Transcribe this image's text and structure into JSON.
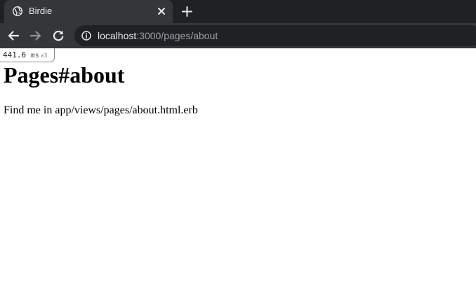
{
  "browser": {
    "tab": {
      "title": "Birdie",
      "favicon": "globe-icon",
      "close": "close-icon"
    },
    "new_tab": "plus-icon",
    "nav": {
      "back": "back-arrow-icon",
      "forward": "forward-arrow-icon",
      "reload": "reload-icon"
    },
    "address": {
      "security": "info-icon",
      "host": "localhost",
      "rest": ":3000/pages/about"
    },
    "colors": {
      "tabstrip": "#202124",
      "toolbar": "#35363a",
      "text": "#e8eaed",
      "muted": "#9aa0a6"
    }
  },
  "profiler": {
    "time": "441.6",
    "unit": "ms",
    "count": "×3"
  },
  "page": {
    "heading": "Pages#about",
    "text": "Find me in app/views/pages/about.html.erb"
  }
}
